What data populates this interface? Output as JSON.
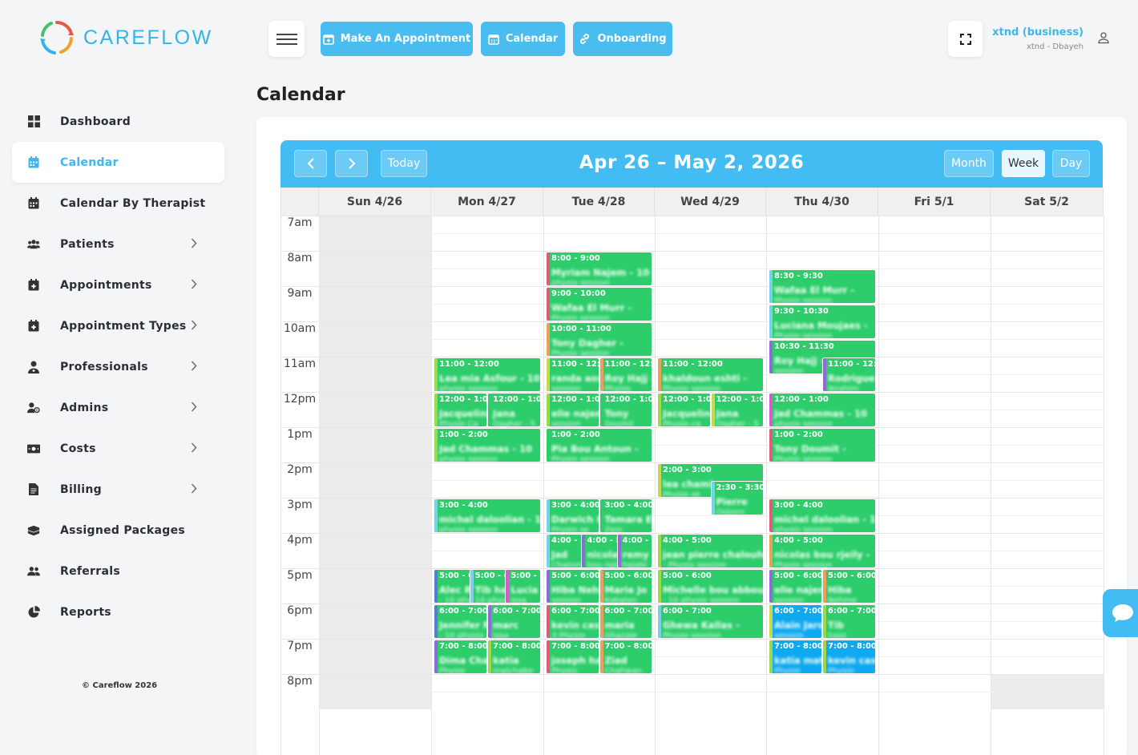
{
  "brand": {
    "name": "CAREFLOW"
  },
  "sidebar": {
    "items": [
      {
        "label": "Dashboard",
        "icon": "dashboard-grid-icon",
        "has_submenu": false,
        "active": false
      },
      {
        "label": "Calendar",
        "icon": "calendar-icon",
        "has_submenu": false,
        "active": true
      },
      {
        "label": "Calendar By Therapist",
        "icon": "calendar-icon",
        "has_submenu": false,
        "active": false
      },
      {
        "label": "Patients",
        "icon": "users-icon",
        "has_submenu": true,
        "active": false
      },
      {
        "label": "Appointments",
        "icon": "calendar-plus-icon",
        "has_submenu": true,
        "active": false
      },
      {
        "label": "Appointment Types",
        "icon": "calendar-plus-icon",
        "has_submenu": true,
        "active": false
      },
      {
        "label": "Professionals",
        "icon": "doctor-icon",
        "has_submenu": true,
        "active": false
      },
      {
        "label": "Admins",
        "icon": "user-cog-icon",
        "has_submenu": true,
        "active": false
      },
      {
        "label": "Costs",
        "icon": "money-icon",
        "has_submenu": true,
        "active": false
      },
      {
        "label": "Billing",
        "icon": "invoice-icon",
        "has_submenu": true,
        "active": false
      },
      {
        "label": "Assigned Packages",
        "icon": "package-icon",
        "has_submenu": false,
        "active": false
      },
      {
        "label": "Referrals",
        "icon": "user-group-icon",
        "has_submenu": false,
        "active": false
      },
      {
        "label": "Reports",
        "icon": "pie-chart-icon",
        "has_submenu": false,
        "active": false
      }
    ],
    "copyright": "© Careflow 2026"
  },
  "topbar": {
    "buttons": [
      {
        "label": "Make An Appointment",
        "icon": "calendar-plus-icon"
      },
      {
        "label": "Calendar",
        "icon": "calendar-icon"
      },
      {
        "label": "Onboarding",
        "icon": "link-icon"
      }
    ],
    "user": {
      "name": "xtnd (business)",
      "location": "xtnd - Dbayeh"
    }
  },
  "page": {
    "title": "Calendar"
  },
  "calendar": {
    "range_title": "Apr 26 – May 2, 2026",
    "today_label": "Today",
    "views": [
      {
        "label": "Month",
        "active": false
      },
      {
        "label": "Week",
        "active": true
      },
      {
        "label": "Day",
        "active": false
      }
    ],
    "days": [
      "Sun 4/26",
      "Mon 4/27",
      "Tue 4/28",
      "Wed 4/29",
      "Thu 4/30",
      "Fri 5/1",
      "Sat 5/2"
    ],
    "hours": [
      "7am",
      "8am",
      "9am",
      "10am",
      "11am",
      "12pm",
      "1pm",
      "2pm",
      "3pm",
      "4pm",
      "5pm",
      "6pm",
      "7pm",
      "8pm"
    ],
    "colors": {
      "event": "#2ccd6a",
      "event_alt": "#0ea9f0",
      "header": "#42bcf2",
      "accent": "#3fb6ec"
    },
    "events": [
      {
        "day": 2,
        "start": 8,
        "end": 9,
        "col": 0,
        "cols": 1,
        "time": "8:00 - 9:00",
        "name": "Myriam Najem - 10",
        "detail": "physio session",
        "stripe": "#e25a7a"
      },
      {
        "day": 2,
        "start": 9,
        "end": 10,
        "col": 0,
        "cols": 1,
        "time": "9:00 - 10:00",
        "name": "Wafaa El Murr -",
        "detail": "Physio session",
        "stripe": "#e25a7a"
      },
      {
        "day": 2,
        "start": 10,
        "end": 11,
        "col": 0,
        "cols": 1,
        "time": "10:00 - 11:00",
        "name": "Tony Dagher -",
        "detail": "Physio session",
        "stripe": "#e8a05a"
      },
      {
        "day": 4,
        "start": 8.5,
        "end": 9.5,
        "col": 0,
        "cols": 1,
        "time": "8:30 - 9:30",
        "name": "Wafaa El Murr -",
        "detail": "Physio session",
        "stripe": "#7ad0e8"
      },
      {
        "day": 4,
        "start": 9.5,
        "end": 10.5,
        "col": 0,
        "cols": 1,
        "time": "9:30 - 10:30",
        "name": "Luciana Moujaes -",
        "detail": "Physio session",
        "stripe": "#7ad0e8"
      },
      {
        "day": 4,
        "start": 10.5,
        "end": 11.5,
        "col": 0,
        "cols": 1,
        "time": "10:30 - 11:30",
        "name": "Roy Hajj -",
        "detail": "session",
        "stripe": "#8e6bd8"
      },
      {
        "day": 4,
        "start": 11,
        "end": 12,
        "col": 1,
        "cols": 2,
        "time": "11:00 - 12:00",
        "name": "Rodrigue",
        "detail": "Ibrahim",
        "stripe": "#8e6bd8"
      },
      {
        "day": 1,
        "start": 11,
        "end": 12,
        "col": 0,
        "cols": 1,
        "time": "11:00 - 12:00",
        "name": "Lea mia Asfour - 10",
        "detail": "physio session",
        "stripe": "#9bd84a"
      },
      {
        "day": 2,
        "start": 11,
        "end": 12,
        "col": 0,
        "cols": 2,
        "time": "11:00 - 12:00",
        "name": "randa aoun",
        "detail": "session",
        "stripe": "#c9d84a"
      },
      {
        "day": 2,
        "start": 11,
        "end": 12,
        "col": 1,
        "cols": 2,
        "time": "11:00 - 12:00",
        "name": "Roy Hajj -",
        "detail": "Physio",
        "stripe": "#e8a05a"
      },
      {
        "day": 3,
        "start": 11,
        "end": 12,
        "col": 0,
        "cols": 1,
        "time": "11:00 - 12:00",
        "name": "khaldoun eshti -",
        "detail": "Physio session",
        "stripe": "#e8a05a"
      },
      {
        "day": 1,
        "start": 12,
        "end": 13,
        "col": 0,
        "cols": 2,
        "time": "12:00 - 1:00",
        "name": "Jacqueline",
        "detail": "Physio Ca",
        "stripe": "#9bd84a"
      },
      {
        "day": 1,
        "start": 12,
        "end": 13,
        "col": 1,
        "cols": 2,
        "time": "12:00 - 1:00",
        "name": "Jana",
        "detail": "Dagher - 5",
        "stripe": "#2ccd6a"
      },
      {
        "day": 2,
        "start": 12,
        "end": 13,
        "col": 0,
        "cols": 2,
        "time": "12:00 - 1:00",
        "name": "elie najem",
        "detail": "session",
        "stripe": "#9bd84a"
      },
      {
        "day": 2,
        "start": 12,
        "end": 13,
        "col": 1,
        "cols": 2,
        "time": "12:00 - 1:00",
        "name": "Tony",
        "detail": "Doumit",
        "stripe": "#2ccd6a"
      },
      {
        "day": 3,
        "start": 12,
        "end": 13,
        "col": 0,
        "cols": 2,
        "time": "12:00 - 1:00",
        "name": "Jacqueline",
        "detail": "Physio ca",
        "stripe": "#9bd84a"
      },
      {
        "day": 3,
        "start": 12,
        "end": 13,
        "col": 1,
        "cols": 2,
        "time": "12:00 - 1:00",
        "name": "Jana",
        "detail": "Dagher - 5",
        "stripe": "#c9d84a"
      },
      {
        "day": 4,
        "start": 12,
        "end": 13,
        "col": 0,
        "cols": 1,
        "time": "12:00 - 1:00",
        "name": "Jad Chammas - 10",
        "detail": "physio session",
        "stripe": "#d85ad0"
      },
      {
        "day": 1,
        "start": 13,
        "end": 14,
        "col": 0,
        "cols": 1,
        "time": "1:00 - 2:00",
        "name": "Jad Chammas - 10",
        "detail": "physio session",
        "stripe": "#9bd84a"
      },
      {
        "day": 2,
        "start": 13,
        "end": 14,
        "col": 0,
        "cols": 1,
        "time": "1:00 - 2:00",
        "name": "Pia Bou Antoun -",
        "detail": "Physio session",
        "stripe": "#2ccd6a"
      },
      {
        "day": 4,
        "start": 13,
        "end": 14,
        "col": 0,
        "cols": 1,
        "time": "1:00 - 2:00",
        "name": "Tony Doumit -",
        "detail": "Physio session",
        "stripe": "#e25a7a"
      },
      {
        "day": 3,
        "start": 14,
        "end": 15,
        "col": 0,
        "cols": 1,
        "time": "2:00 - 3:00",
        "name": "lea chami",
        "detail": "Physio se",
        "stripe": "#c9d84a"
      },
      {
        "day": 3,
        "start": 14.5,
        "end": 15.5,
        "col": 1,
        "cols": 2,
        "time": "2:30 - 3:30",
        "name": "Pierre",
        "detail": "Osborn",
        "stripe": "#7ad0e8"
      },
      {
        "day": 1,
        "start": 15,
        "end": 16,
        "col": 0,
        "cols": 1,
        "time": "3:00 - 4:00",
        "name": "michel daloolian - 10",
        "detail": "physio session",
        "stripe": "#7ad0e8"
      },
      {
        "day": 2,
        "start": 15,
        "end": 16,
        "col": 0,
        "cols": 2,
        "time": "3:00 - 4:00",
        "name": "Darwich Kh",
        "detail": "Physio se",
        "stripe": "#7ad0e8"
      },
      {
        "day": 2,
        "start": 15,
        "end": 16,
        "col": 1,
        "cols": 2,
        "time": "3:00 - 4:00",
        "name": "Tamara El",
        "detail": "Zein",
        "stripe": "#2ccd6a"
      },
      {
        "day": 4,
        "start": 15,
        "end": 16,
        "col": 0,
        "cols": 1,
        "time": "3:00 - 4:00",
        "name": "michel daloolian - 10",
        "detail": "physio session",
        "stripe": "#e25a7a"
      },
      {
        "day": 2,
        "start": 16,
        "end": 17,
        "col": 0,
        "cols": 3,
        "time": "4:00 - 5:00",
        "name": "Jad",
        "detail": "Chammas",
        "stripe": "#7ad0e8"
      },
      {
        "day": 2,
        "start": 16,
        "end": 17,
        "col": 1,
        "cols": 3,
        "time": "4:00 - 5:00",
        "name": "nicolas",
        "detail": "bou rjeily",
        "stripe": "#8e6bd8"
      },
      {
        "day": 2,
        "start": 16,
        "end": 17,
        "col": 2,
        "cols": 3,
        "time": "4:00 - 5:00",
        "name": "remy",
        "detail": "halabi",
        "stripe": "#8e6bd8"
      },
      {
        "day": 3,
        "start": 16,
        "end": 17,
        "col": 0,
        "cols": 1,
        "time": "4:00 - 5:00",
        "name": "jean pierre chalouhi",
        "detail": "- Physio session",
        "stripe": "#9bd84a"
      },
      {
        "day": 4,
        "start": 16,
        "end": 17,
        "col": 0,
        "cols": 1,
        "time": "4:00 - 5:00",
        "name": "nicolas bou rjeily -",
        "detail": "Physio session",
        "stripe": "#e8a05a"
      },
      {
        "day": 1,
        "start": 17,
        "end": 18,
        "col": 0,
        "cols": 3,
        "time": "5:00 - 6:00",
        "name": "Alec Rizk",
        "detail": "- 10 physio",
        "stripe": "#5a7ad8"
      },
      {
        "day": 1,
        "start": 17,
        "end": 18,
        "col": 1,
        "cols": 3,
        "time": "5:00 - 6:00",
        "name": "Tib hazz",
        "detail": "10 physio",
        "stripe": "#7ad0e8"
      },
      {
        "day": 1,
        "start": 17,
        "end": 18,
        "col": 2,
        "cols": 3,
        "time": "5:00 - 6:00",
        "name": "Lucia",
        "detail": "Issa",
        "stripe": "#d85ad0"
      },
      {
        "day": 2,
        "start": 17,
        "end": 18,
        "col": 0,
        "cols": 2,
        "time": "5:00 - 6:00",
        "name": "Hiba Nehme",
        "detail": "session",
        "stripe": "#8e6bd8"
      },
      {
        "day": 2,
        "start": 17,
        "end": 18,
        "col": 1,
        "cols": 2,
        "time": "5:00 - 6:00",
        "name": "Marie Jo",
        "detail": "Kabalan",
        "stripe": "#e8a05a"
      },
      {
        "day": 3,
        "start": 17,
        "end": 18,
        "col": 0,
        "cols": 1,
        "time": "5:00 - 6:00",
        "name": "Michelle bou abboud",
        "detail": "- 10 physio session",
        "stripe": "#9bd84a"
      },
      {
        "day": 4,
        "start": 17,
        "end": 18,
        "col": 0,
        "cols": 2,
        "time": "5:00 - 6:00",
        "name": "elie najem",
        "detail": "session",
        "stripe": "#8e6bd8"
      },
      {
        "day": 4,
        "start": 17,
        "end": 18,
        "col": 1,
        "cols": 2,
        "time": "5:00 - 6:00",
        "name": "Hiba",
        "detail": "Nehme",
        "stripe": "#e8a05a"
      },
      {
        "day": 1,
        "start": 18,
        "end": 19,
        "col": 0,
        "cols": 2,
        "time": "6:00 - 7:00",
        "name": "Jennifer M",
        "detail": "- 10 physio",
        "stripe": "#5a7ad8"
      },
      {
        "day": 1,
        "start": 18,
        "end": 19,
        "col": 1,
        "cols": 2,
        "time": "6:00 - 7:00",
        "name": "marc",
        "detail": "Issa",
        "stripe": "#8e6bd8"
      },
      {
        "day": 2,
        "start": 18,
        "end": 19,
        "col": 0,
        "cols": 2,
        "time": "6:00 - 7:00",
        "name": "kevin cas",
        "detail": "3 Physio",
        "stripe": "#e25a7a"
      },
      {
        "day": 2,
        "start": 18,
        "end": 19,
        "col": 1,
        "cols": 2,
        "time": "6:00 - 7:00",
        "name": "maria",
        "detail": "Ghazale",
        "stripe": "#e8a05a"
      },
      {
        "day": 3,
        "start": 18,
        "end": 19,
        "col": 0,
        "cols": 1,
        "time": "6:00 - 7:00",
        "name": "Ghewa Kallas -",
        "detail": "Physio session",
        "stripe": "#7ad0e8"
      },
      {
        "day": 4,
        "start": 18,
        "end": 19,
        "col": 0,
        "cols": 2,
        "time": "6:00 - 7:00",
        "name": "Alain Jaroudi",
        "detail": "session",
        "stripe": "#c9d84a",
        "alt": true
      },
      {
        "day": 4,
        "start": 18,
        "end": 19,
        "col": 1,
        "cols": 2,
        "time": "6:00 - 7:00",
        "name": "Tib",
        "detail": "hazz",
        "stripe": "#9bd84a"
      },
      {
        "day": 1,
        "start": 19,
        "end": 20,
        "col": 0,
        "cols": 2,
        "time": "7:00 - 8:00",
        "name": "Dima Chartouni",
        "detail": "Physio",
        "stripe": "#8e6bd8"
      },
      {
        "day": 1,
        "start": 19,
        "end": 20,
        "col": 1,
        "cols": 2,
        "time": "7:00 - 8:00",
        "name": "katia",
        "detail": "matchabe",
        "stripe": "#9bd84a"
      },
      {
        "day": 2,
        "start": 19,
        "end": 20,
        "col": 0,
        "cols": 2,
        "time": "7:00 - 8:00",
        "name": "joseph hajj",
        "detail": "Physio",
        "stripe": "#e25a7a"
      },
      {
        "day": 2,
        "start": 19,
        "end": 20,
        "col": 1,
        "cols": 2,
        "time": "7:00 - 8:00",
        "name": "Ziad",
        "detail": "Chahwan",
        "stripe": "#e8a05a"
      },
      {
        "day": 4,
        "start": 19,
        "end": 20,
        "col": 0,
        "cols": 2,
        "time": "7:00 - 8:00",
        "name": "katia matchabe",
        "detail": "Physio",
        "stripe": "#9bd84a",
        "alt": true
      },
      {
        "day": 4,
        "start": 19,
        "end": 20,
        "col": 1,
        "cols": 2,
        "time": "7:00 - 8:00",
        "name": "kevin cas",
        "detail": "Physio",
        "stripe": "#9bd84a",
        "alt": true
      }
    ]
  }
}
